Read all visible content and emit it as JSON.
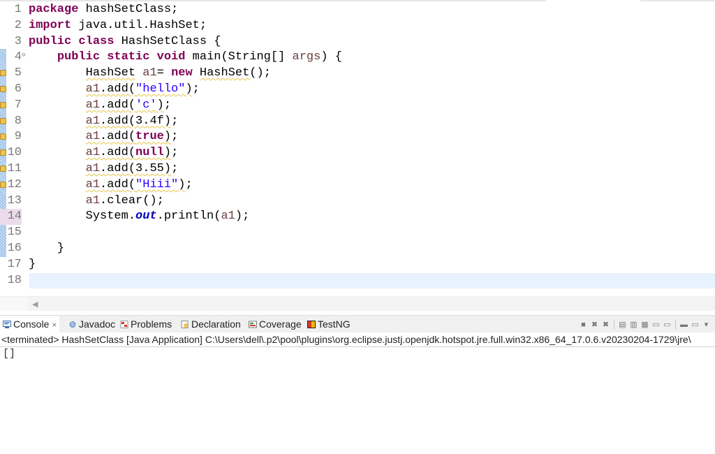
{
  "editor": {
    "lines": [
      {
        "num": "1",
        "tokens": [
          {
            "t": "package",
            "c": "kw"
          },
          {
            "t": " hashSetClass;"
          }
        ]
      },
      {
        "num": "2",
        "tokens": [
          {
            "t": "import",
            "c": "kw"
          },
          {
            "t": " java.util.HashSet;"
          }
        ]
      },
      {
        "num": "3",
        "tokens": [
          {
            "t": "public",
            "c": "kw"
          },
          {
            "t": " "
          },
          {
            "t": "class",
            "c": "kw"
          },
          {
            "t": " HashSetClass {"
          }
        ]
      },
      {
        "num": "4",
        "fold": true,
        "tokens": [
          {
            "t": "    "
          },
          {
            "t": "public",
            "c": "kw"
          },
          {
            "t": " "
          },
          {
            "t": "static",
            "c": "kw"
          },
          {
            "t": " "
          },
          {
            "t": "void",
            "c": "kw"
          },
          {
            "t": " main(String[] "
          },
          {
            "t": "args",
            "c": "var"
          },
          {
            "t": ") {"
          }
        ]
      },
      {
        "num": "5",
        "warning": true,
        "tokens": [
          {
            "t": "        "
          },
          {
            "t": "HashSet",
            "c": "warn"
          },
          {
            "t": " "
          },
          {
            "t": "a1",
            "c": "var"
          },
          {
            "t": "= "
          },
          {
            "t": "new",
            "c": "kw"
          },
          {
            "t": " "
          },
          {
            "t": "HashSet",
            "c": "warn"
          },
          {
            "t": "();"
          }
        ]
      },
      {
        "num": "6",
        "warning": true,
        "tokens": [
          {
            "t": "        "
          },
          {
            "t": "a1",
            "c": "var warn"
          },
          {
            "t": ".add(",
            "c": "warn"
          },
          {
            "t": "\"hello\"",
            "c": "str warn"
          },
          {
            "t": ")",
            "c": "warn"
          },
          {
            "t": ";"
          }
        ]
      },
      {
        "num": "7",
        "warning": true,
        "tokens": [
          {
            "t": "        "
          },
          {
            "t": "a1",
            "c": "var warn"
          },
          {
            "t": ".add(",
            "c": "warn"
          },
          {
            "t": "'c'",
            "c": "str warn"
          },
          {
            "t": ")",
            "c": "warn"
          },
          {
            "t": ";"
          }
        ]
      },
      {
        "num": "8",
        "warning": true,
        "tokens": [
          {
            "t": "        "
          },
          {
            "t": "a1",
            "c": "var warn"
          },
          {
            "t": ".add(3.4f)",
            "c": "warn"
          },
          {
            "t": ";"
          }
        ]
      },
      {
        "num": "9",
        "warning": true,
        "tokens": [
          {
            "t": "        "
          },
          {
            "t": "a1",
            "c": "var warn"
          },
          {
            "t": ".add(",
            "c": "warn"
          },
          {
            "t": "true",
            "c": "kw warn"
          },
          {
            "t": ")",
            "c": "warn"
          },
          {
            "t": ";"
          }
        ]
      },
      {
        "num": "10",
        "warning": true,
        "tokens": [
          {
            "t": "        "
          },
          {
            "t": "a1",
            "c": "var warn"
          },
          {
            "t": ".add(",
            "c": "warn"
          },
          {
            "t": "null",
            "c": "kw warn"
          },
          {
            "t": ")",
            "c": "warn"
          },
          {
            "t": ";"
          }
        ]
      },
      {
        "num": "11",
        "warning": true,
        "tokens": [
          {
            "t": "        "
          },
          {
            "t": "a1",
            "c": "var warn"
          },
          {
            "t": ".add(3.55)",
            "c": "warn"
          },
          {
            "t": ";"
          }
        ]
      },
      {
        "num": "12",
        "warning": true,
        "tokens": [
          {
            "t": "        "
          },
          {
            "t": "a1",
            "c": "var warn"
          },
          {
            "t": ".add(",
            "c": "warn"
          },
          {
            "t": "\"Hiii\"",
            "c": "str warn"
          },
          {
            "t": ")",
            "c": "warn"
          },
          {
            "t": ";"
          }
        ]
      },
      {
        "num": "13",
        "tokens": [
          {
            "t": "        "
          },
          {
            "t": "a1",
            "c": "var"
          },
          {
            "t": ".clear();"
          }
        ]
      },
      {
        "num": "14",
        "current_marker": true,
        "tokens": [
          {
            "t": "        System."
          },
          {
            "t": "out",
            "c": "fld"
          },
          {
            "t": ".println("
          },
          {
            "t": "a1",
            "c": "var"
          },
          {
            "t": ");"
          }
        ]
      },
      {
        "num": "15",
        "tokens": []
      },
      {
        "num": "16",
        "tokens": [
          {
            "t": "    }"
          }
        ]
      },
      {
        "num": "17",
        "tokens": [
          {
            "t": "}"
          }
        ]
      },
      {
        "num": "18",
        "current_line": true,
        "tokens": []
      }
    ]
  },
  "views": {
    "tabs": [
      {
        "label": "Console",
        "icon": "console-icon",
        "active": true,
        "closable": true
      },
      {
        "label": "Javadoc",
        "icon": "javadoc-icon"
      },
      {
        "label": "Problems",
        "icon": "problems-icon"
      },
      {
        "label": "Declaration",
        "icon": "declaration-icon"
      },
      {
        "label": "Coverage",
        "icon": "coverage-icon"
      },
      {
        "label": "TestNG",
        "icon": "testng-icon"
      }
    ],
    "close_glyph": "×",
    "toolbar": [
      {
        "name": "terminate-icon",
        "glyph": "■"
      },
      {
        "name": "remove-launch-icon",
        "glyph": "✖"
      },
      {
        "name": "remove-all-terminated-icon",
        "glyph": "✖"
      },
      {
        "sep": true
      },
      {
        "name": "clear-console-icon",
        "glyph": "▤"
      },
      {
        "name": "scroll-lock-icon",
        "glyph": "▥"
      },
      {
        "name": "word-wrap-icon",
        "glyph": "▦"
      },
      {
        "name": "show-on-stdout-icon",
        "glyph": "▭"
      },
      {
        "name": "show-on-stderr-icon",
        "glyph": "▭"
      },
      {
        "sep": true
      },
      {
        "name": "pin-console-icon",
        "glyph": "▬"
      },
      {
        "name": "display-console-icon",
        "glyph": "▭"
      },
      {
        "name": "view-menu-icon",
        "glyph": "▾"
      }
    ]
  },
  "console": {
    "status": "<terminated> HashSetClass [Java Application] C:\\Users\\dell\\.p2\\pool\\plugins\\org.eclipse.justj.openjdk.hotspot.jre.full.win32.x86_64_17.0.6.v20230204-1729\\jre\\",
    "output": "[]"
  },
  "colors": {
    "keyword": "#7f0055",
    "string": "#2a00ff",
    "local_var": "#6a3e3e",
    "static_field": "#0000c0",
    "current_line": "#e8f2fe",
    "warning_underline": "#e8c34a"
  }
}
